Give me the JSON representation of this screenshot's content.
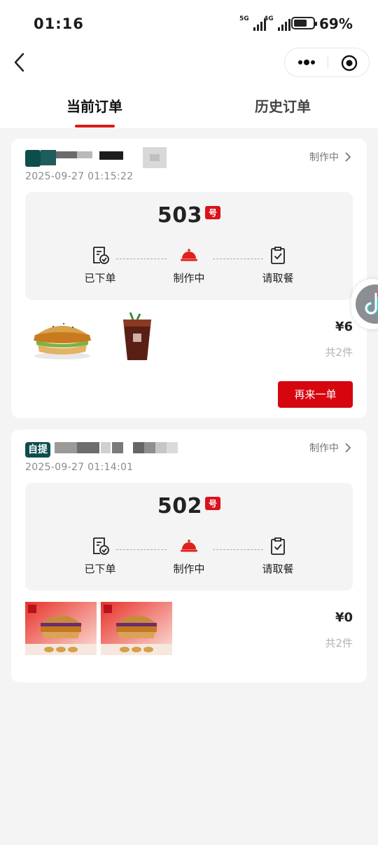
{
  "status_bar": {
    "time": "01:16",
    "signal1": "5G",
    "signal2": "4G",
    "battery_percent": "69%",
    "battery_level": 0.69
  },
  "tabs": [
    {
      "label": "当前订单",
      "active": true
    },
    {
      "label": "历史订单",
      "active": false
    }
  ],
  "orders": [
    {
      "badge": "",
      "status": "制作中",
      "time": "2025-09-27 01:15:22",
      "number": "503",
      "number_suffix": "号",
      "steps": [
        "已下单",
        "制作中",
        "请取餐"
      ],
      "price": "¥6",
      "count": "共2件",
      "reorder_label": "再来一单"
    },
    {
      "badge": "自提",
      "status": "制作中",
      "time": "2025-09-27 01:14:01",
      "number": "502",
      "number_suffix": "号",
      "steps": [
        "已下单",
        "制作中",
        "请取餐"
      ],
      "price": "¥0",
      "count": "共2件"
    }
  ],
  "colors": {
    "accent_red": "#d6060f",
    "badge_teal": "#0d4d4d",
    "card_bg": "#ffffff",
    "page_bg": "#f4f4f4"
  },
  "icons": {
    "back": "chevron-left-icon",
    "more": "more-dots-icon",
    "close": "target-circle-icon",
    "ordered": "receipt-check-icon",
    "making": "cloche-icon",
    "pickup": "clipboard-check-icon"
  }
}
